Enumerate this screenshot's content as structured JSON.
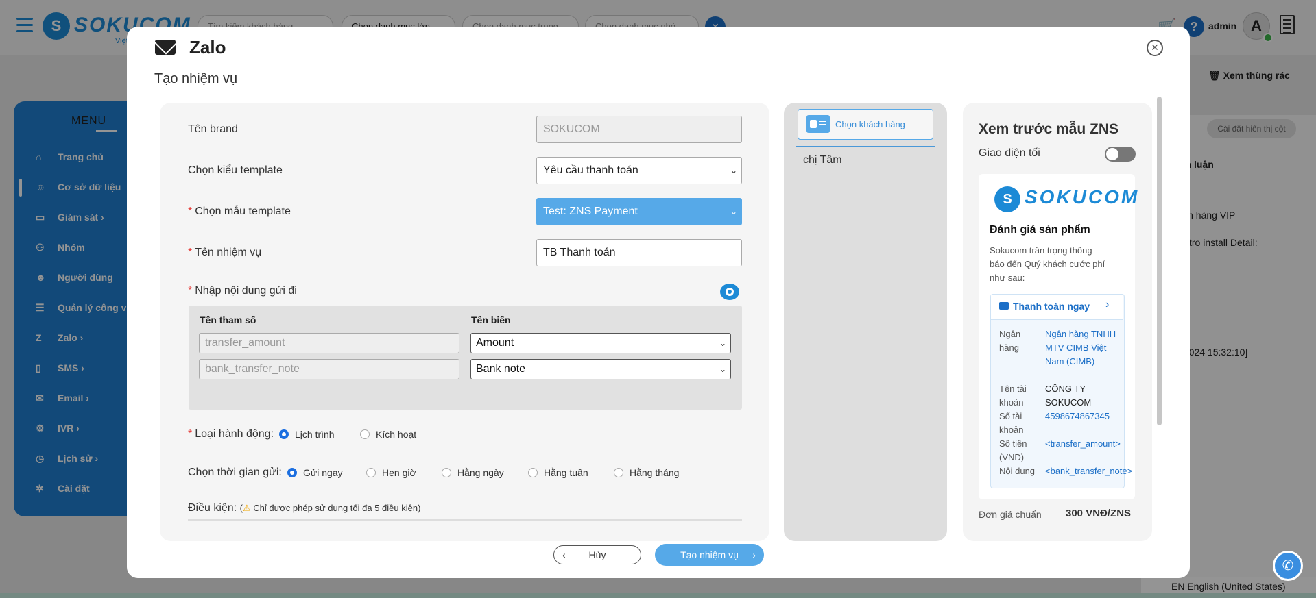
{
  "app": {
    "logo_text": "SOKUCOM",
    "logo_sub": "Việt",
    "search_placeholder": "Tìm kiếm khách hàng",
    "filter1": "Chọn danh mục lớn",
    "filter2": "Chọn danh mục trung",
    "filter3": "Chọn danh mục nhỏ",
    "user": "admin",
    "avatar_letter": "A",
    "trash_button": "Xem thùng rác",
    "column_settings": "Cài đặt hiển thị cột",
    "language": "EN English (United States)",
    "bg_texts": {
      "col_header": "nh luận",
      "row1": "ich hàng VIP",
      "row2": "tro install Detail:",
      "row3": "/2024 15:32:10]"
    }
  },
  "sidebar": {
    "title": "MENU",
    "items": [
      {
        "label": "Trang chủ"
      },
      {
        "label": "Cơ sở dữ liệu"
      },
      {
        "label": "Giám sát"
      },
      {
        "label": "Nhóm"
      },
      {
        "label": "Người dùng"
      },
      {
        "label": "Quản lý công v"
      },
      {
        "label": "Zalo"
      },
      {
        "label": "SMS"
      },
      {
        "label": "Email"
      },
      {
        "label": "IVR"
      },
      {
        "label": "Lịch sử"
      },
      {
        "label": "Cài đặt"
      }
    ]
  },
  "modal": {
    "title": "Zalo",
    "subtitle": "Tạo nhiệm vụ",
    "form": {
      "brand_label": "Tên brand",
      "brand_value": "SOKUCOM",
      "template_type_label": "Chọn kiểu template",
      "template_type_value": "Yêu cầu thanh toán",
      "template_label": "Chọn mẫu template",
      "template_value": "Test: ZNS Payment",
      "task_name_label": "Tên nhiệm vụ",
      "task_name_value": "TB Thanh toán",
      "content_label": "Nhập nội dung gửi đi",
      "param_header": "Tên tham số",
      "var_header": "Tên biến",
      "params": [
        {
          "name": "transfer_amount",
          "variable": "Amount"
        },
        {
          "name": "bank_transfer_note",
          "variable": "Bank note"
        }
      ],
      "action_label": "Loại hành động:",
      "action_options": [
        "Lịch trình",
        "Kích hoạt"
      ],
      "time_label": "Chọn thời gian gửi:",
      "time_options": [
        "Gửi ngay",
        "Hẹn giờ",
        "Hằng ngày",
        "Hằng tuần",
        "Hằng tháng"
      ],
      "condition_label": "Điều kiện:",
      "condition_note": "Chỉ được phép sử dụng tối đa 5 điều kiện)"
    },
    "customer": {
      "choose_button": "Chọn khách hàng",
      "selected": "chị Tâm"
    },
    "preview": {
      "title": "Xem trước mẫu ZNS",
      "dark_mode_label": "Giao diện tối",
      "logo_text": "SOKUCOM",
      "heading": "Đánh giá sản phẩm",
      "body": "Sokucom trân trọng thông báo đến Quý khách cước phí như sau:",
      "pay_button": "Thanh toán ngay",
      "rows": [
        {
          "key": "Ngân hàng",
          "value": "Ngân hàng TNHH MTV CIMB Việt Nam (CIMB)"
        },
        {
          "key": "Tên tài khoản",
          "value": "CÔNG TY SOKUCOM"
        },
        {
          "key": "Số tài khoản",
          "value": "4598674867345"
        },
        {
          "key": "Số tiền (VND)",
          "value": "<transfer_amount>"
        },
        {
          "key": "Nội dung",
          "value": "<bank_transfer_note>"
        }
      ],
      "price_label": "Đơn giá chuẩn",
      "price_value": "300 VNĐ/ZNS"
    },
    "cancel_button": "Hủy",
    "create_button": "Tạo nhiệm vụ"
  },
  "colors": {
    "brand": "#1c8ad6",
    "accent": "#56a9e8",
    "required": "#e53935"
  }
}
